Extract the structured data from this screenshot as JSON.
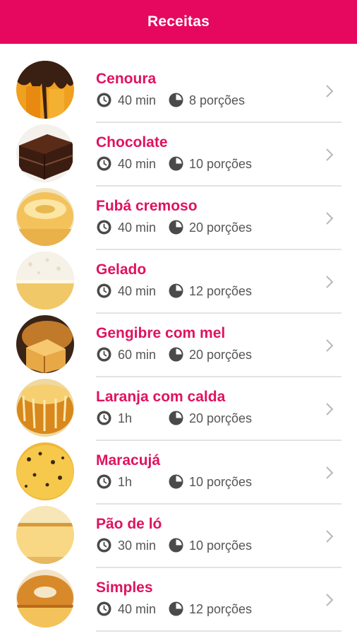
{
  "header": {
    "title": "Receitas"
  },
  "icons": {
    "time": "clock-icon",
    "servings": "pie-chart-icon",
    "next": "chevron-right-icon"
  },
  "colors": {
    "accent": "#e6075f",
    "title_text": "#e0125f",
    "meta_text": "#555555"
  },
  "recipes": [
    {
      "name": "Cenoura",
      "time": "40 min",
      "servings": "8 porções"
    },
    {
      "name": "Chocolate",
      "time": "40 min",
      "servings": "10 porções"
    },
    {
      "name": "Fubá cremoso",
      "time": "40 min",
      "servings": "20 porções"
    },
    {
      "name": "Gelado",
      "time": "40 min",
      "servings": "12 porções"
    },
    {
      "name": "Gengibre com mel",
      "time": "60 min",
      "servings": "20 porções"
    },
    {
      "name": "Laranja com calda",
      "time": "1h",
      "servings": "20 porções"
    },
    {
      "name": "Maracujá",
      "time": "1h",
      "servings": "10 porções"
    },
    {
      "name": "Pão de ló",
      "time": "30 min",
      "servings": "10 porções"
    },
    {
      "name": "Simples",
      "time": "40 min",
      "servings": "12 porções"
    }
  ]
}
